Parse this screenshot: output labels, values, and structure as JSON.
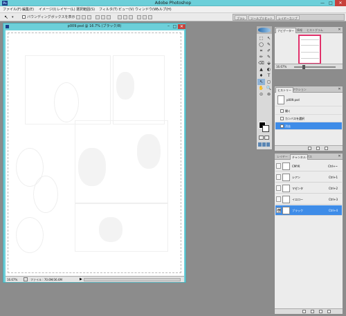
{
  "app": {
    "title": "Adobe Photoshop",
    "logo": "Ps",
    "min": "—",
    "max": "□",
    "close": "✕"
  },
  "menu": [
    "ファイル(F)",
    "編集(E)",
    "イメージ(I)",
    "レイヤー(L)",
    "選択範囲(S)",
    "フィルタ(T)",
    "ビュー(V)",
    "ウィンドウ(W)",
    "ヘルプ(H)"
  ],
  "options": {
    "tool_icon": "↖",
    "dropdown": "▾",
    "checkbox_label": "バウンディングボックスを表示",
    "palette_well_tabs": [
      "ブラシ",
      "ツールプリセット",
      "レイヤーカンプ"
    ]
  },
  "document": {
    "title": "p009.psd @ 16.7% (ブラック/8)",
    "min": "–",
    "max": "□",
    "close": "✕",
    "zoom": "16.67%",
    "info": "ファイル : 70.6M/36.6M",
    "arrow": "▶"
  },
  "toolbox": {
    "tools": [
      "⬚",
      "↖",
      "◯",
      "✎",
      "⌗",
      "✐",
      "✏",
      "✎",
      "⌫",
      "⬙",
      "▲",
      "◐",
      "♦",
      "T",
      "↖",
      "◻",
      "✋",
      "🔍",
      "⊙",
      "⊚"
    ],
    "selected_index": 14
  },
  "navigator": {
    "tabs": [
      "ナビゲーター",
      "情報",
      "ヒストグラム"
    ],
    "zoom": "16.67%",
    "close": "✕"
  },
  "history": {
    "tabs": [
      "ヒストリー",
      "アクション"
    ],
    "snapshot": "p009.psd",
    "items": [
      "開く",
      "カンバスを選択",
      "消去"
    ],
    "active_index": 2,
    "close": "✕"
  },
  "layers": {
    "tabs": [
      "レイヤー",
      "チャンネル",
      "パス"
    ],
    "channels": [
      {
        "name": "CMYK",
        "shortcut": "Ctrl+~"
      },
      {
        "name": "シアン",
        "shortcut": "Ctrl+1"
      },
      {
        "name": "マゼンタ",
        "shortcut": "Ctrl+2"
      },
      {
        "name": "イエロー",
        "shortcut": "Ctrl+3"
      },
      {
        "name": "ブラック",
        "shortcut": "Ctrl+4"
      }
    ],
    "active_index": 4,
    "eye": "👁",
    "close": "✕"
  },
  "colors": {
    "window_chrome": "#6ccfd9",
    "selection": "#3e8ce8",
    "navigator_view": "#e0306a",
    "workspace": "#8c8c8c"
  }
}
